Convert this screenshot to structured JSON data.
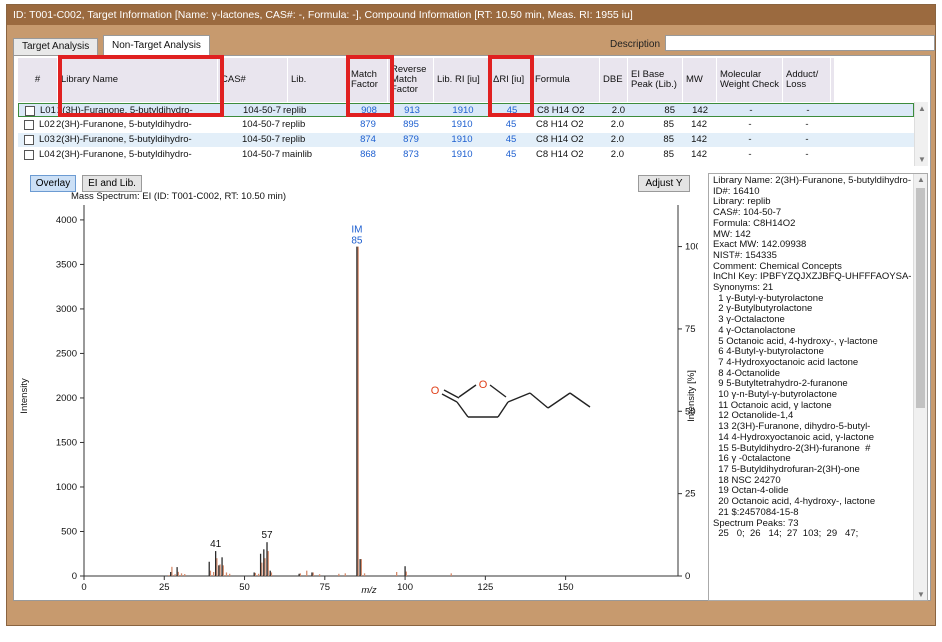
{
  "window": {
    "title": "ID: T001-C002, Target Information [Name: γ-lactones, CAS#: -, Formula: -], Compound Information [RT: 10.50 min, Meas. RI: 1955 iu]"
  },
  "tabs": [
    {
      "label": "Target Analysis",
      "active": false
    },
    {
      "label": "Non-Target Analysis",
      "active": true
    }
  ],
  "description": {
    "label": "Description",
    "value": ""
  },
  "table": {
    "headers": {
      "num": "#",
      "library_name": "Library Name",
      "cas": "CAS#",
      "lib": "Lib.",
      "match_factor": "Match Factor",
      "reverse_match_factor": "Reverse Match Factor",
      "lib_ri": "Lib. RI [iu]",
      "delta_ri": "ΔRI [iu]",
      "formula": "Formula",
      "dbe": "DBE",
      "ei_base_peak": "EI Base Peak (Lib.)",
      "mw": "MW",
      "mw_check": "Molecular Weight Check",
      "adduct_loss": "Adduct/ Loss"
    },
    "rows": [
      {
        "id": "L01",
        "name": "2(3H)-Furanone, 5-butyldihydro-",
        "cas": "104-50-7",
        "lib": "replib",
        "mf": "908",
        "rmf": "913",
        "lib_ri": "1910",
        "dri": "45",
        "formula": "C8 H14 O2",
        "dbe": "2.0",
        "base": "85",
        "mw": "142",
        "mwc": "-",
        "adduct": "-"
      },
      {
        "id": "L02",
        "name": "2(3H)-Furanone, 5-butyldihydro-",
        "cas": "104-50-7",
        "lib": "replib",
        "mf": "879",
        "rmf": "895",
        "lib_ri": "1910",
        "dri": "45",
        "formula": "C8 H14 O2",
        "dbe": "2.0",
        "base": "85",
        "mw": "142",
        "mwc": "-",
        "adduct": "-"
      },
      {
        "id": "L03",
        "name": "2(3H)-Furanone, 5-butyldihydro-",
        "cas": "104-50-7",
        "lib": "replib",
        "mf": "874",
        "rmf": "879",
        "lib_ri": "1910",
        "dri": "45",
        "formula": "C8 H14 O2",
        "dbe": "2.0",
        "base": "85",
        "mw": "142",
        "mwc": "-",
        "adduct": "-"
      },
      {
        "id": "L04",
        "name": "2(3H)-Furanone, 5-butyldihydro-",
        "cas": "104-50-7",
        "lib": "mainlib",
        "mf": "868",
        "rmf": "873",
        "lib_ri": "1910",
        "dri": "45",
        "formula": "C8 H14 O2",
        "dbe": "2.0",
        "base": "85",
        "mw": "142",
        "mwc": "-",
        "adduct": "-"
      }
    ]
  },
  "buttons": {
    "overlay": "Overlay",
    "ei_and_lib": "EI and Lib.",
    "adjust_y": "Adjust Y"
  },
  "colors": {
    "window_frame": "#c79a6e",
    "title_bar": "#9b6a3f",
    "highlight_box": "#e02020",
    "measured_spectrum": "#2b2b2b",
    "library_spectrum": "#d4896a",
    "value_blue": "#1d5fd0",
    "oxygen_red": "#e0401a"
  },
  "chart_data": {
    "type": "bar",
    "title": "Mass Spectrum: EI (ID: T001-C002, RT: 10.50 min)",
    "xlabel": "m/z",
    "ylabel": "Intensity",
    "ylabel_right": "Intensity [%]",
    "xlim": [
      0,
      185
    ],
    "ylim": [
      0,
      4100
    ],
    "ylim_right": [
      0,
      110.8
    ],
    "xticks": [
      0,
      25,
      50,
      75,
      100,
      125,
      150
    ],
    "yticks": [
      0,
      500,
      1000,
      1500,
      2000,
      2500,
      3000,
      3500,
      4000
    ],
    "yticks_right": [
      0,
      25,
      50,
      75,
      100
    ],
    "annotations": [
      {
        "x": 85,
        "label_top": "IM",
        "label_bottom": "85"
      },
      {
        "x": 57,
        "label": "57"
      },
      {
        "x": 41,
        "label": "41"
      }
    ],
    "series": [
      {
        "name": "EI",
        "points": [
          [
            27,
            45
          ],
          [
            29,
            100
          ],
          [
            39,
            160
          ],
          [
            41,
            280
          ],
          [
            42,
            120
          ],
          [
            43,
            210
          ],
          [
            53,
            40
          ],
          [
            55,
            250
          ],
          [
            56,
            300
          ],
          [
            57,
            380
          ],
          [
            58,
            60
          ],
          [
            67,
            25
          ],
          [
            71,
            40
          ],
          [
            85,
            3700
          ],
          [
            86,
            190
          ],
          [
            100,
            110
          ]
        ]
      },
      {
        "name": "Lib.",
        "points": [
          [
            26,
            10
          ],
          [
            27,
            103
          ],
          [
            28,
            20
          ],
          [
            29,
            47
          ],
          [
            30,
            30
          ],
          [
            31,
            22
          ],
          [
            39,
            60
          ],
          [
            40,
            45
          ],
          [
            41,
            200
          ],
          [
            42,
            130
          ],
          [
            43,
            120
          ],
          [
            44,
            40
          ],
          [
            45,
            25
          ],
          [
            53,
            35
          ],
          [
            54,
            25
          ],
          [
            55,
            150
          ],
          [
            56,
            200
          ],
          [
            57,
            280
          ],
          [
            58,
            40
          ],
          [
            67,
            30
          ],
          [
            69,
            60
          ],
          [
            71,
            40
          ],
          [
            73,
            20
          ],
          [
            79,
            25
          ],
          [
            81,
            30
          ],
          [
            85,
            3700
          ],
          [
            86,
            190
          ],
          [
            87,
            30
          ],
          [
            97,
            45
          ],
          [
            100,
            50
          ],
          [
            114,
            30
          ]
        ]
      }
    ]
  },
  "info_pane": {
    "lines": [
      "Library Name: 2(3H)-Furanone, 5-butyldihydro-",
      "ID#: 16410",
      "Library: replib",
      "CAS#: 104-50-7",
      "Formula: C8H14O2",
      "MW: 142",
      "Exact MW: 142.09938",
      "NIST#: 154335",
      "Comment: Chemical Concepts",
      "InChI Key: IPBFYZQJXZJBFQ-UHFFFAOYSA-N",
      "Synonyms: 21",
      "  1 γ-Butyl-γ-butyrolactone",
      "  2 γ-Butylbutyrolactone",
      "  3 γ-Octalactone",
      "  4 γ-Octanolactone",
      "  5 Octanoic acid, 4-hydroxy-, γ-lactone",
      "  6 4-Butyl-γ-butyrolactone",
      "  7 4-Hydroxyoctanoic acid lactone",
      "  8 4-Octanolide",
      "  9 5-Butyltetrahydro-2-furanone",
      "  10 γ-n-Butyl-γ-butyrolactone",
      "  11 Octanoic acid, γ lactone",
      "  12 Octanolide-1,4",
      "  13 2(3H)-Furanone, dihydro-5-butyl-",
      "  14 4-Hydroxyoctanoic acid, γ-lactone",
      "  15 5-Butyldihydro-2(3H)-furanone  #",
      "  16 γ -0ctalactone",
      "  17 5-Butyldihydrofuran-2(3H)-one",
      "  18 NSC 24270",
      "  19 Octan-4-olide",
      "  20 Octanoic acid, 4-hydroxy-, lactone",
      "  21 $:2457084-15-8",
      "Spectrum Peaks: 73",
      "  25   0;  26   14;  27  103;  29   47;"
    ]
  }
}
